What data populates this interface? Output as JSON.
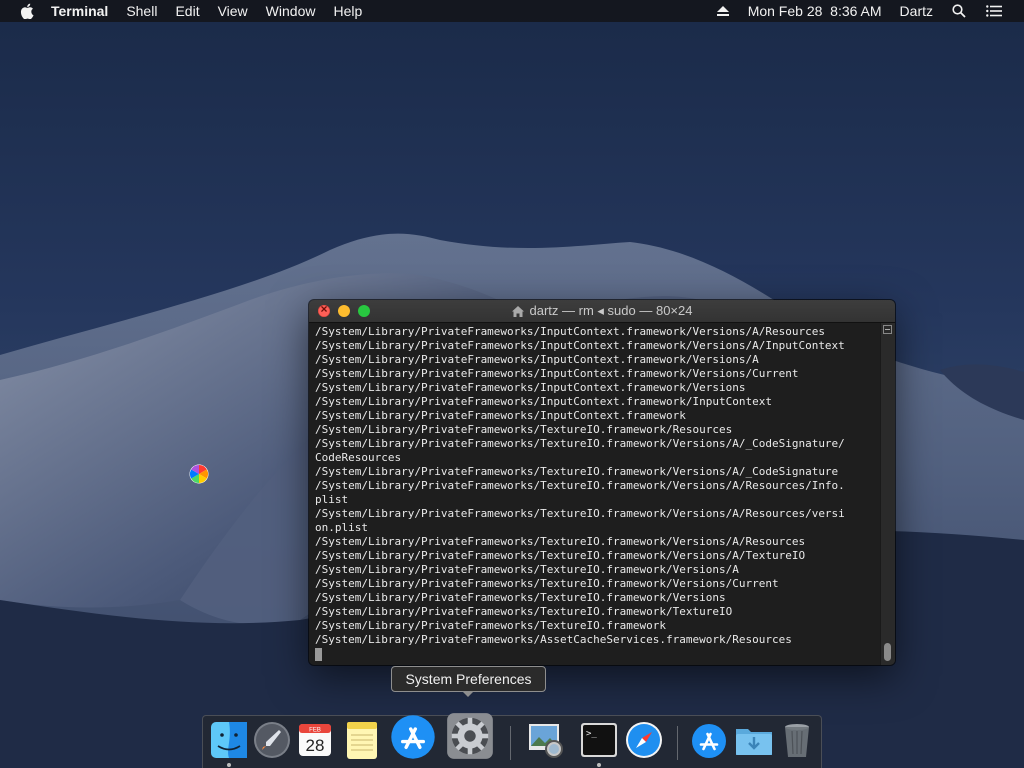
{
  "menubar": {
    "app_name": "Terminal",
    "menus": [
      "Shell",
      "Edit",
      "View",
      "Window",
      "Help"
    ],
    "datetime": "Mon Feb 28  8:36 AM",
    "user": "Dartz"
  },
  "terminal": {
    "title": "dartz — rm ◂ sudo — 80×24",
    "lines": [
      "/System/Library/PrivateFrameworks/InputContext.framework/Versions/A/Resources",
      "/System/Library/PrivateFrameworks/InputContext.framework/Versions/A/InputContext",
      "/System/Library/PrivateFrameworks/InputContext.framework/Versions/A",
      "/System/Library/PrivateFrameworks/InputContext.framework/Versions/Current",
      "/System/Library/PrivateFrameworks/InputContext.framework/Versions",
      "/System/Library/PrivateFrameworks/InputContext.framework/InputContext",
      "/System/Library/PrivateFrameworks/InputContext.framework",
      "/System/Library/PrivateFrameworks/TextureIO.framework/Resources",
      "/System/Library/PrivateFrameworks/TextureIO.framework/Versions/A/_CodeSignature/",
      "CodeResources",
      "/System/Library/PrivateFrameworks/TextureIO.framework/Versions/A/_CodeSignature",
      "/System/Library/PrivateFrameworks/TextureIO.framework/Versions/A/Resources/Info.",
      "plist",
      "/System/Library/PrivateFrameworks/TextureIO.framework/Versions/A/Resources/versi",
      "on.plist",
      "/System/Library/PrivateFrameworks/TextureIO.framework/Versions/A/Resources",
      "/System/Library/PrivateFrameworks/TextureIO.framework/Versions/A/TextureIO",
      "/System/Library/PrivateFrameworks/TextureIO.framework/Versions/A",
      "/System/Library/PrivateFrameworks/TextureIO.framework/Versions/Current",
      "/System/Library/PrivateFrameworks/TextureIO.framework/Versions",
      "/System/Library/PrivateFrameworks/TextureIO.framework/TextureIO",
      "/System/Library/PrivateFrameworks/TextureIO.framework",
      "/System/Library/PrivateFrameworks/AssetCacheServices.framework/Resources"
    ]
  },
  "tooltip": {
    "text": "System Preferences"
  },
  "dock": {
    "items": [
      {
        "name": "finder",
        "icon": "finder-icon",
        "running": true
      },
      {
        "name": "launchpad",
        "icon": "launchpad-icon",
        "running": false
      },
      {
        "name": "calendar",
        "icon": "calendar-icon",
        "running": false,
        "month": "FEB",
        "day": "28"
      },
      {
        "name": "notes",
        "icon": "notes-icon",
        "running": false
      },
      {
        "name": "app-store",
        "icon": "app-store-icon",
        "running": false
      },
      {
        "name": "system-preferences",
        "icon": "gear-icon",
        "running": false
      },
      {
        "name": "preview",
        "icon": "preview-icon",
        "running": false
      },
      {
        "name": "terminal",
        "icon": "terminal-icon",
        "running": true
      },
      {
        "name": "safari",
        "icon": "safari-icon",
        "running": false
      },
      {
        "name": "app-store-folder",
        "icon": "app-store-icon",
        "running": false
      },
      {
        "name": "downloads",
        "icon": "downloads-folder-icon",
        "running": false
      },
      {
        "name": "trash",
        "icon": "trash-icon",
        "running": false
      }
    ]
  },
  "colors": {
    "terminal_bg": "#1e1e1e",
    "terminal_text": "#e9e9e9",
    "close": "#fe5f57",
    "minimize": "#febc2e",
    "zoom": "#28c840"
  }
}
